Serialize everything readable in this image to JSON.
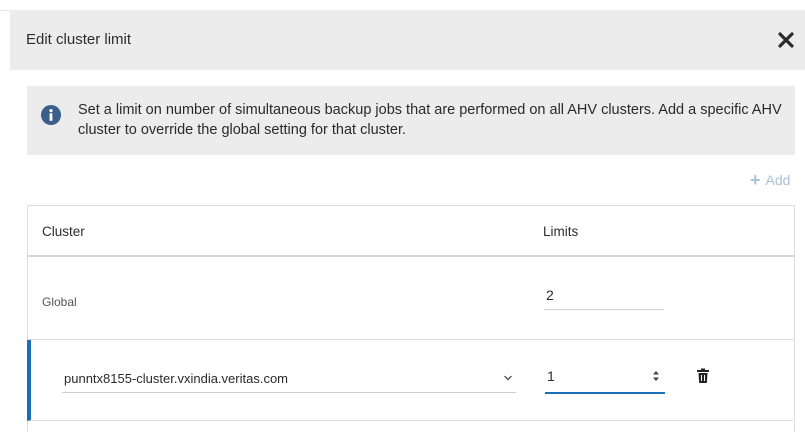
{
  "dialog": {
    "title": "Edit cluster limit",
    "close_icon": "close-icon"
  },
  "info": {
    "icon": "info-icon",
    "text": "Set a limit on number of simultaneous backup jobs that are performed on all AHV clusters. Add a specific AHV cluster to override the global setting for that cluster."
  },
  "toolbar": {
    "add_label": "Add",
    "add_icon": "plus-icon"
  },
  "table": {
    "columns": [
      "Cluster",
      "Limits"
    ],
    "global_row": {
      "label": "Global",
      "limit": "2"
    },
    "cluster_rows": [
      {
        "cluster": "punntx8155-cluster.vxindia.veritas.com",
        "limit": "1"
      }
    ]
  },
  "colors": {
    "header_bg": "#ececec",
    "accent": "#1a6fb5",
    "add_link": "#a9c0d6",
    "info_icon": "#3a5f8a"
  }
}
